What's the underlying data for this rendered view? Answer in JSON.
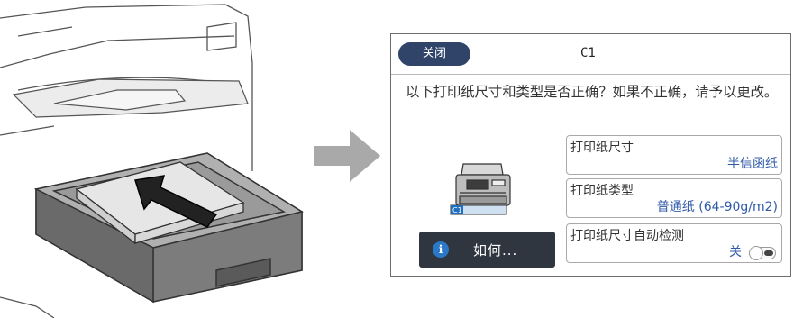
{
  "panel": {
    "close_label": "关闭",
    "title": "C1",
    "question": "以下打印纸尺寸和类型是否正确？如果不正确，请予以更改。",
    "tray_badge": "C1",
    "settings": [
      {
        "label": "打印纸尺寸",
        "value": "半信函纸"
      },
      {
        "label": "打印纸类型",
        "value": "普通纸 (64-90g/m2)"
      },
      {
        "label": "打印纸尺寸自动检测",
        "value": "关",
        "toggle_state": "off"
      }
    ],
    "howto_label": "如何..."
  },
  "colors": {
    "close_button": "#2f4468",
    "value_text": "#2f5aa8",
    "howto_button": "#2f3640",
    "info_icon": "#2a78c8",
    "arrow": "#a9a9a9"
  },
  "icons": [
    "printer-icon",
    "info-icon",
    "arrow-right-icon"
  ]
}
